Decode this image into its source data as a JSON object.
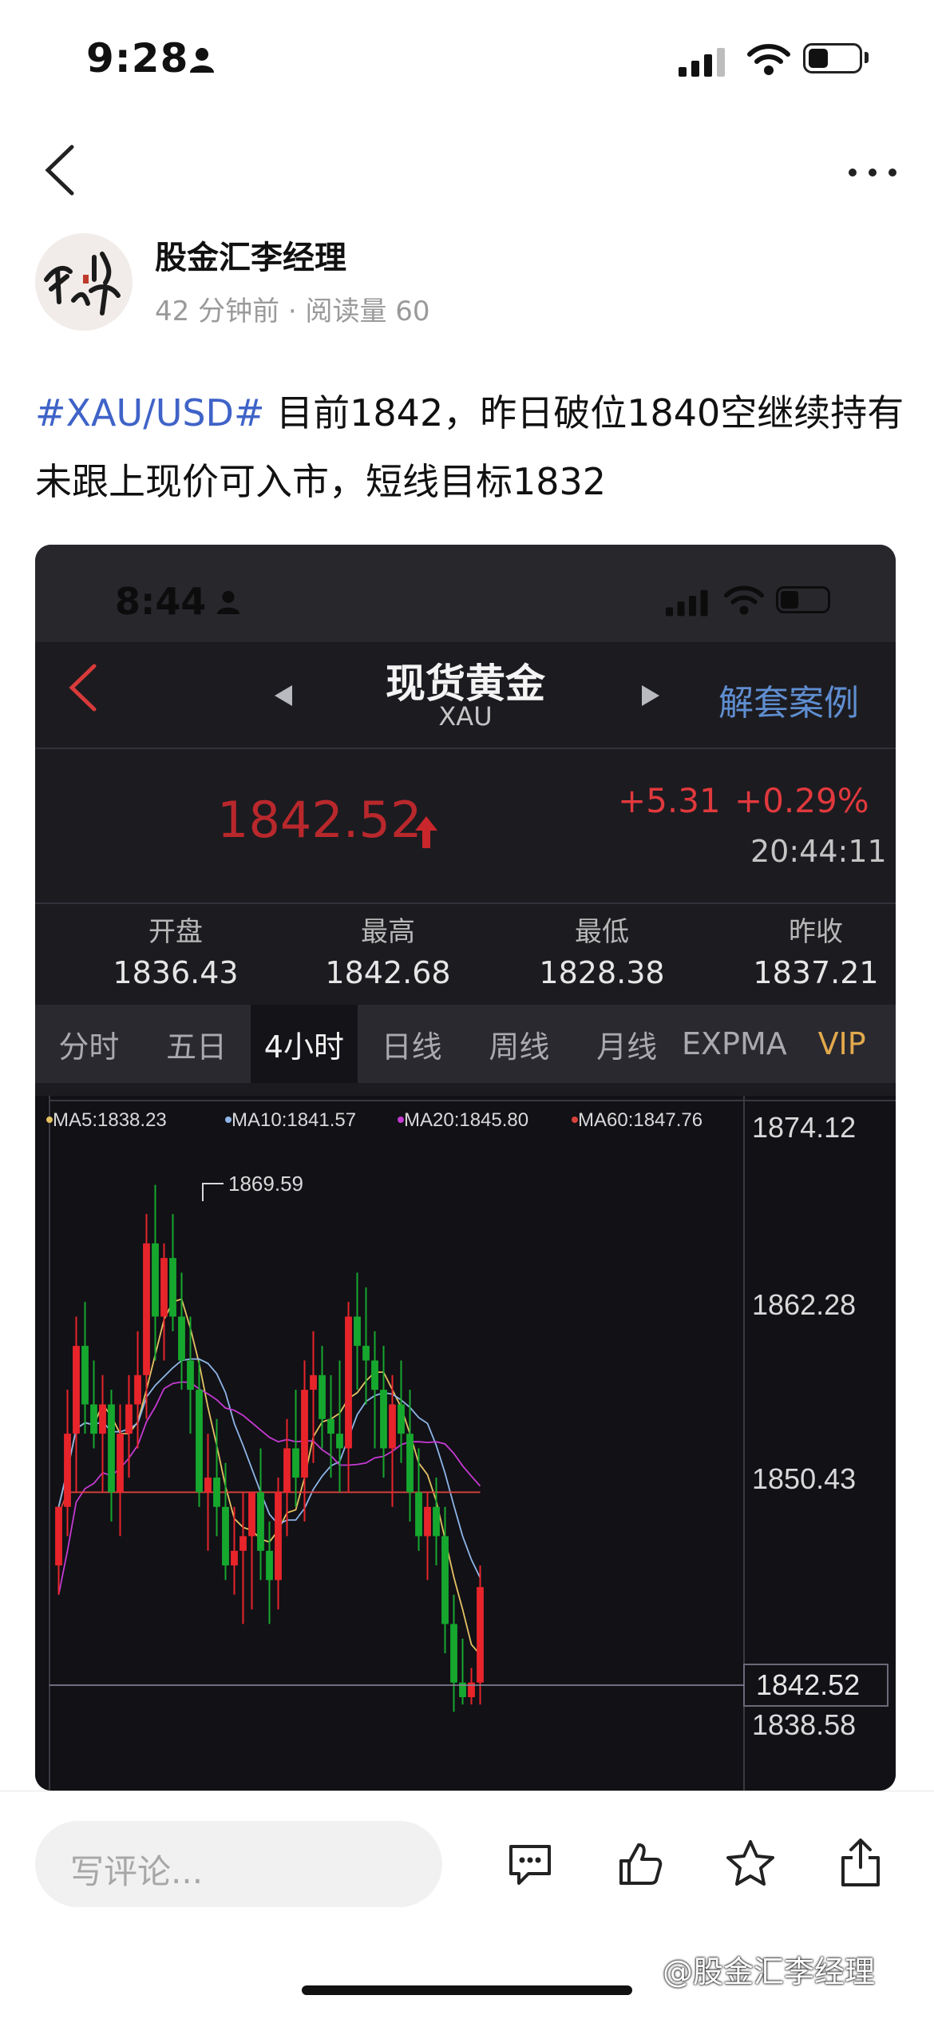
{
  "status_bar": {
    "time": "9:28"
  },
  "post": {
    "author": "股金汇李经理",
    "meta": "42 分钟前 · 阅读量 60",
    "tag": "#XAU/USD#",
    "text": " 目前1842，昨日破位1840空继续持有 未跟上现价可入市，短线目标1832"
  },
  "screenshot": {
    "status_time": "8:44",
    "title": "现货黄金",
    "subtitle": "XAU",
    "right_link": "解套案例",
    "price": "1842.52",
    "change": "+5.31",
    "change_pct": "+0.29%",
    "clock": "20:44:11",
    "stats": [
      {
        "label": "开盘",
        "value": "1836.43"
      },
      {
        "label": "最高",
        "value": "1842.68"
      },
      {
        "label": "最低",
        "value": "1828.38"
      },
      {
        "label": "昨收",
        "value": "1837.21"
      }
    ],
    "tabs": [
      "分时",
      "五日",
      "4小时",
      "日线",
      "周线",
      "月线",
      "EXPMA",
      "VIP"
    ],
    "active_tab": "4小时",
    "colors": {
      "up": "#e8242b",
      "down": "#16a82e",
      "ma5": "#e6c263",
      "ma10": "#8eb6e8",
      "ma20": "#c43ad1",
      "ma60": "#d8423c"
    }
  },
  "chart_data": {
    "type": "candlestick",
    "legend": [
      "MA5:1838.23",
      "MA10:1841.57",
      "MA20:1845.80",
      "MA60:1847.76"
    ],
    "y_ticks": [
      "1874.12",
      "1862.28",
      "1850.43",
      "1838.58"
    ],
    "current_price_label": "1842.52",
    "high_annotation": "1869.59",
    "ylim": [
      1834.5,
      1874.12
    ],
    "candles": [
      [
        1844,
        1848,
        1842,
        1848
      ],
      [
        1848,
        1856,
        1846,
        1853
      ],
      [
        1853,
        1861,
        1849,
        1859
      ],
      [
        1859,
        1862,
        1853,
        1855
      ],
      [
        1855,
        1858,
        1852,
        1853
      ],
      [
        1853,
        1857,
        1849,
        1855
      ],
      [
        1855,
        1856,
        1847,
        1849
      ],
      [
        1849,
        1855,
        1846,
        1853
      ],
      [
        1853,
        1857,
        1850,
        1855
      ],
      [
        1855,
        1860,
        1852,
        1857
      ],
      [
        1857,
        1868,
        1854,
        1866
      ],
      [
        1866,
        1870,
        1858,
        1861
      ],
      [
        1861,
        1866,
        1858,
        1865
      ],
      [
        1865,
        1868,
        1860,
        1861
      ],
      [
        1861,
        1864,
        1856,
        1858
      ],
      [
        1858,
        1861,
        1853,
        1856
      ],
      [
        1856,
        1858,
        1848,
        1849
      ],
      [
        1849,
        1853,
        1845,
        1850
      ],
      [
        1850,
        1854,
        1846,
        1848
      ],
      [
        1848,
        1851,
        1843,
        1844
      ],
      [
        1844,
        1848,
        1842,
        1845
      ],
      [
        1845,
        1849,
        1840,
        1846
      ],
      [
        1846,
        1849,
        1841,
        1849
      ],
      [
        1849,
        1852,
        1843,
        1845
      ],
      [
        1845,
        1847,
        1840,
        1843
      ],
      [
        1843,
        1850,
        1841,
        1849
      ],
      [
        1849,
        1854,
        1846,
        1852
      ],
      [
        1852,
        1856,
        1848,
        1850
      ],
      [
        1850,
        1858,
        1847,
        1856
      ],
      [
        1856,
        1860,
        1851,
        1857
      ],
      [
        1857,
        1859,
        1852,
        1854
      ],
      [
        1854,
        1857,
        1850,
        1853
      ],
      [
        1853,
        1858,
        1849,
        1852
      ],
      [
        1852,
        1862,
        1849,
        1861
      ],
      [
        1861,
        1864,
        1856,
        1859
      ],
      [
        1859,
        1863,
        1855,
        1858
      ],
      [
        1858,
        1860,
        1852,
        1856
      ],
      [
        1856,
        1859,
        1850,
        1852
      ],
      [
        1852,
        1857,
        1848,
        1855
      ],
      [
        1855,
        1858,
        1851,
        1853
      ],
      [
        1853,
        1856,
        1847,
        1849
      ],
      [
        1849,
        1852,
        1845,
        1846
      ],
      [
        1846,
        1849,
        1843,
        1848
      ],
      [
        1848,
        1850,
        1844,
        1846
      ],
      [
        1846,
        1848,
        1838,
        1840
      ],
      [
        1840,
        1842,
        1834,
        1836
      ],
      [
        1836,
        1839,
        1834.5,
        1835
      ],
      [
        1835,
        1837,
        1834.5,
        1836
      ],
      [
        1836,
        1844,
        1834.5,
        1842.52
      ]
    ]
  },
  "comment_bar": {
    "placeholder": "写评论..."
  },
  "watermark": "@股金汇李经理"
}
